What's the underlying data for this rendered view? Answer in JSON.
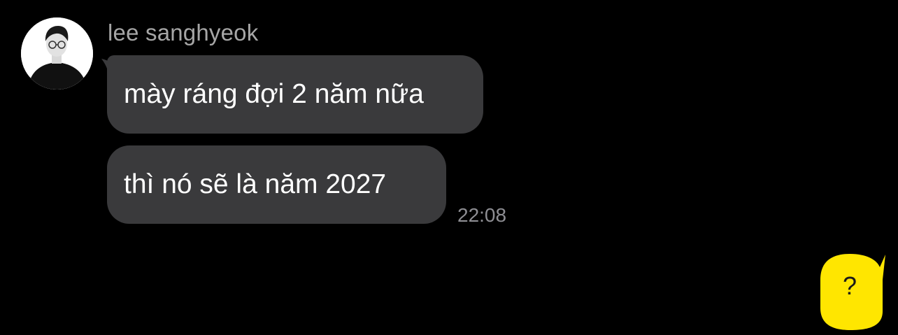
{
  "conversation": {
    "sender_name": "lee sanghyeok",
    "messages": [
      {
        "text": "mày ráng đợi 2 năm nữa"
      },
      {
        "text": "thì nó sẽ là năm 2027"
      }
    ],
    "last_message_time": "22:08"
  },
  "fab": {
    "label": "?",
    "color": "#ffe600"
  },
  "colors": {
    "background": "#000000",
    "bubble": "#3a3a3c",
    "bubble_text": "#ffffff",
    "name_text": "#a6a6a6",
    "time_text": "#8e8e93"
  },
  "icons": {
    "avatar": "profile-photo",
    "fab": "speech-bubble-icon"
  }
}
